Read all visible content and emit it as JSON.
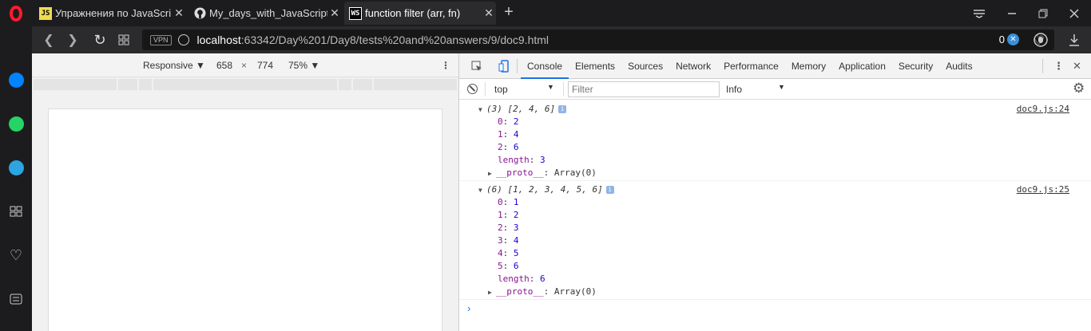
{
  "tabs": [
    {
      "favicon": "JS",
      "title": "Упражнения по JavaScript",
      "active": false
    },
    {
      "favicon": "github",
      "title": "My_days_with_JavaScript/D",
      "active": false
    },
    {
      "favicon": "WS",
      "title": "function filter (arr, fn)",
      "active": true
    }
  ],
  "address": {
    "vpn": "VPN",
    "host": "localhost",
    "path": ":63342/Day%201/Day8/tests%20and%20answers/9/doc9.html",
    "adblock_count": "0"
  },
  "device_toolbar": {
    "mode": "Responsive",
    "width": "658",
    "times": "×",
    "height": "774",
    "zoom": "75%"
  },
  "devtools": {
    "tabs": [
      "Console",
      "Elements",
      "Sources",
      "Network",
      "Performance",
      "Memory",
      "Application",
      "Security",
      "Audits"
    ],
    "active_tab": "Console",
    "context": "top",
    "filter_placeholder": "Filter",
    "level": "Info"
  },
  "console": {
    "entries": [
      {
        "summary_count": "(3)",
        "summary_values": "[2, 4, 6]",
        "source": "doc9.js:24",
        "items": [
          {
            "k": "0",
            "v": "2"
          },
          {
            "k": "1",
            "v": "4"
          },
          {
            "k": "2",
            "v": "6"
          }
        ],
        "length_label": "length",
        "length": "3",
        "proto_label": "__proto__",
        "proto": "Array(0)"
      },
      {
        "summary_count": "(6)",
        "summary_values": "[1, 2, 3, 4, 5, 6]",
        "source": "doc9.js:25",
        "items": [
          {
            "k": "0",
            "v": "1"
          },
          {
            "k": "1",
            "v": "2"
          },
          {
            "k": "2",
            "v": "3"
          },
          {
            "k": "3",
            "v": "4"
          },
          {
            "k": "4",
            "v": "5"
          },
          {
            "k": "5",
            "v": "6"
          }
        ],
        "length_label": "length",
        "length": "6",
        "proto_label": "__proto__",
        "proto": "Array(0)"
      }
    ],
    "prompt": "›"
  },
  "colors": {
    "accent": "#1a73e8",
    "opera_red": "#ff1b2d",
    "messenger": "#0084ff",
    "whatsapp": "#25d366",
    "telegram": "#2ca5e0"
  }
}
